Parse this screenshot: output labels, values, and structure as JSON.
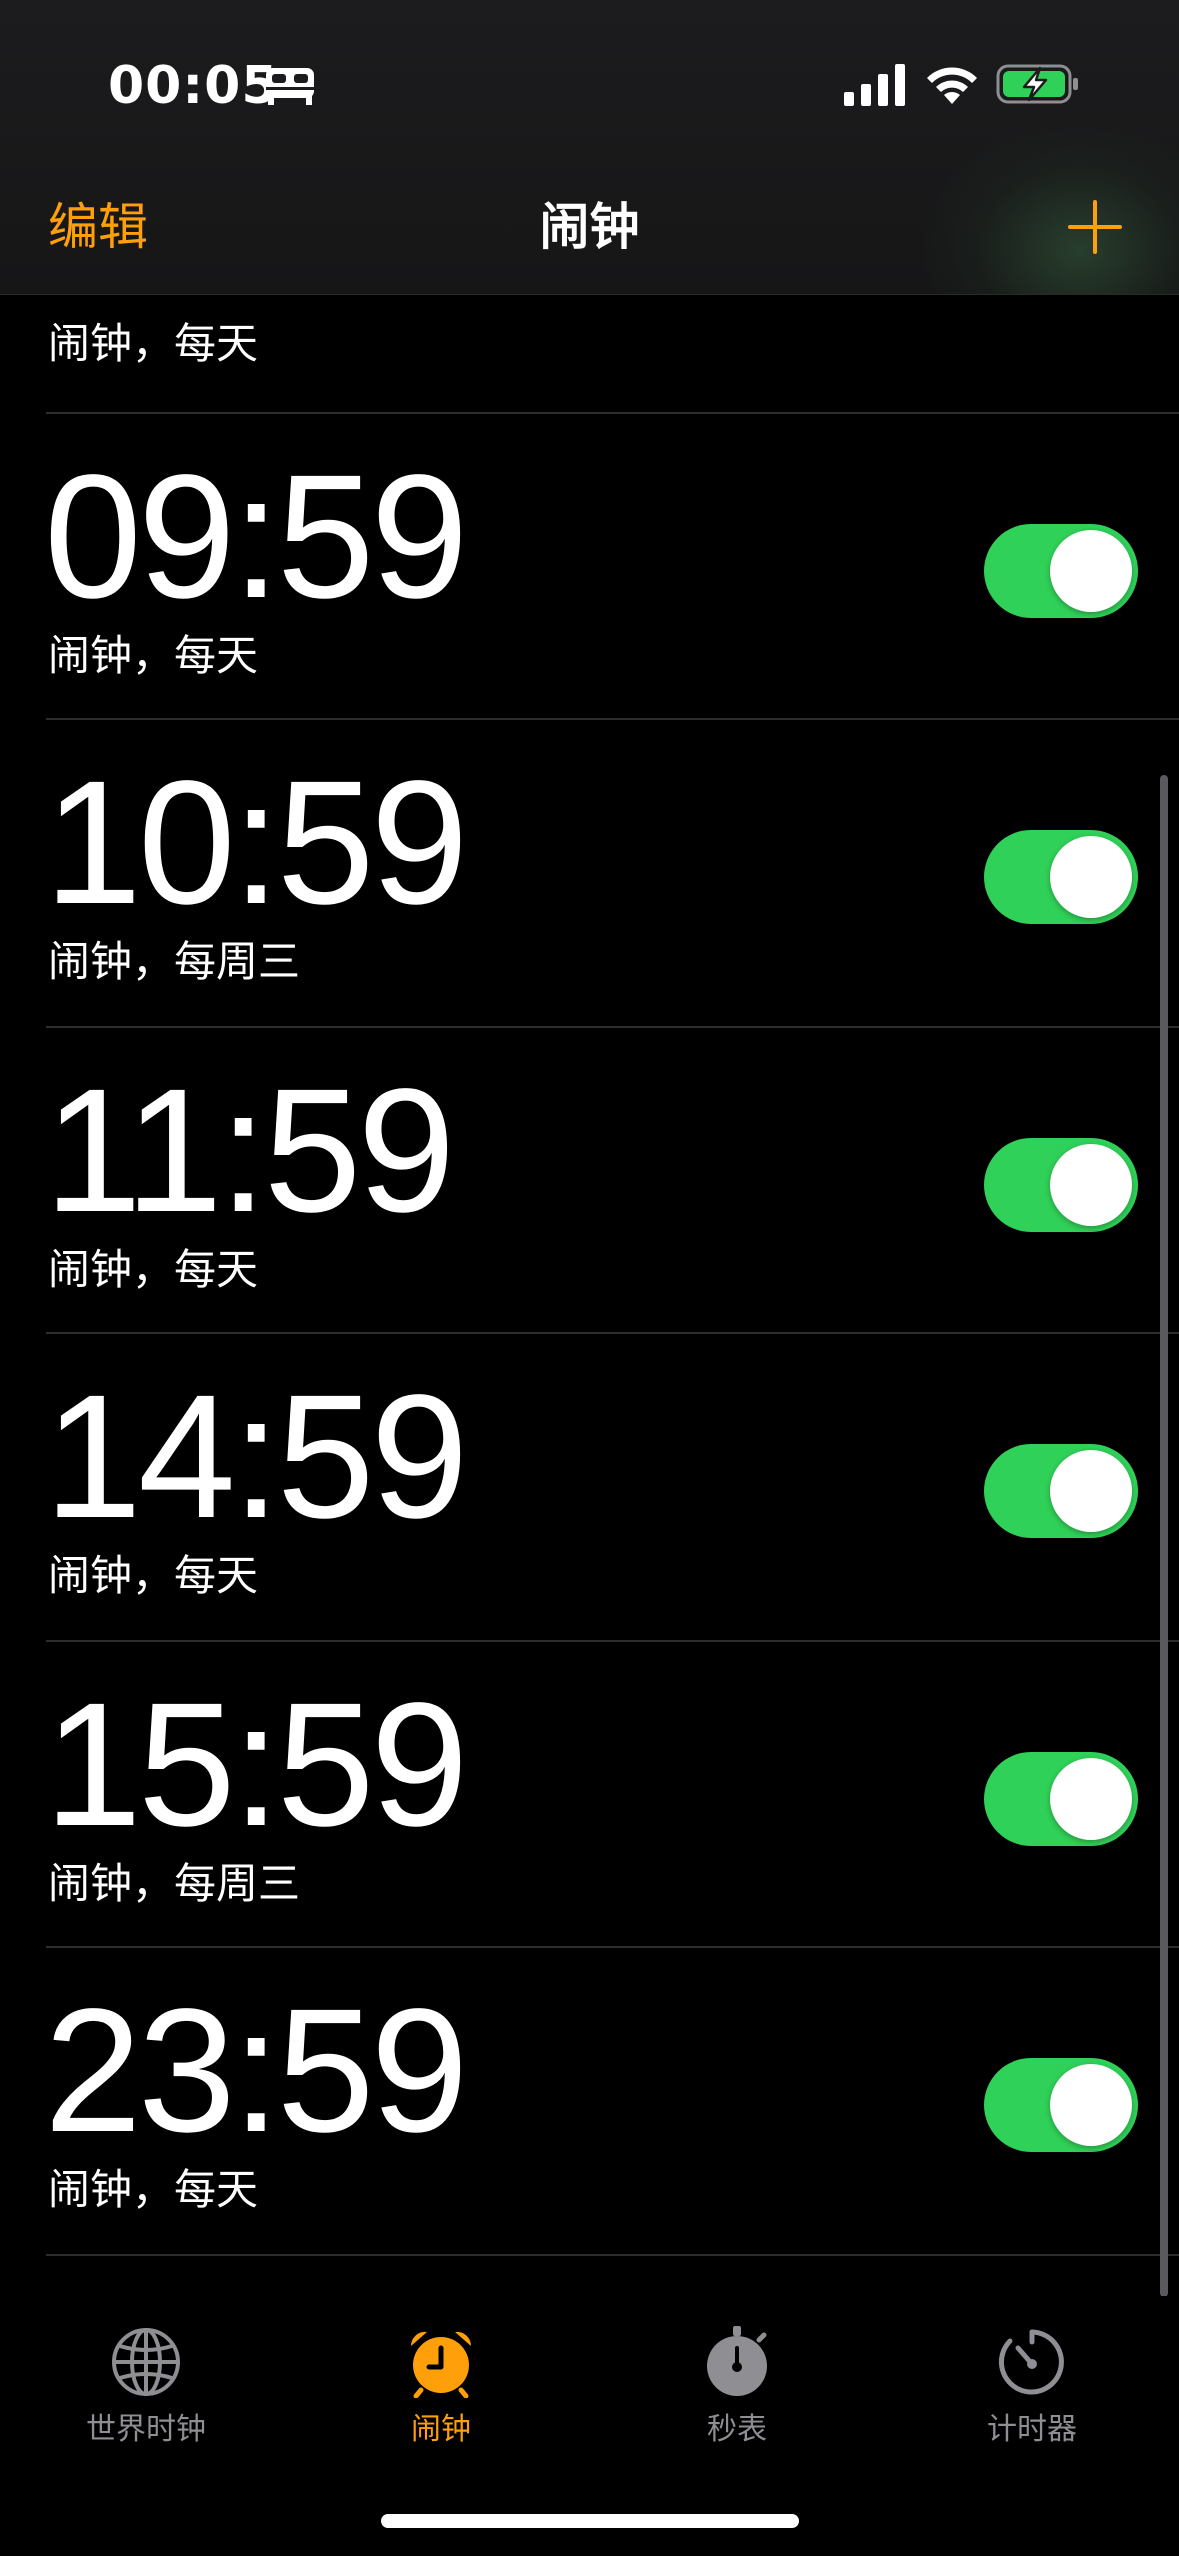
{
  "status_bar": {
    "time": "00:05",
    "focus_icon": "bed-icon",
    "signal_icon": "cellular-signal-icon",
    "wifi_icon": "wifi-icon",
    "battery_icon": "battery-charging-icon"
  },
  "nav": {
    "edit_label": "编辑",
    "title": "闹钟",
    "add_icon": "plus-icon"
  },
  "partial_row_label": "闹钟，每天",
  "alarms": [
    {
      "time": "09:59",
      "label": "闹钟，每天",
      "enabled": true
    },
    {
      "time": "10:59",
      "label": "闹钟，每周三",
      "enabled": true
    },
    {
      "time": "11:59",
      "label": "闹钟，每天",
      "enabled": true
    },
    {
      "time": "14:59",
      "label": "闹钟，每天",
      "enabled": true
    },
    {
      "time": "15:59",
      "label": "闹钟，每周三",
      "enabled": true
    },
    {
      "time": "23:59",
      "label": "闹钟，每天",
      "enabled": true
    }
  ],
  "tabs": [
    {
      "label": "世界时钟",
      "icon": "globe-icon",
      "active": false
    },
    {
      "label": "闹钟",
      "icon": "alarm-clock-icon",
      "active": true
    },
    {
      "label": "秒表",
      "icon": "stopwatch-icon",
      "active": false
    },
    {
      "label": "计时器",
      "icon": "timer-icon",
      "active": false
    }
  ],
  "colors": {
    "accent": "#ff9f0a",
    "toggle_on": "#30d158",
    "inactive_tab": "#8e8e93",
    "background": "#000000"
  }
}
